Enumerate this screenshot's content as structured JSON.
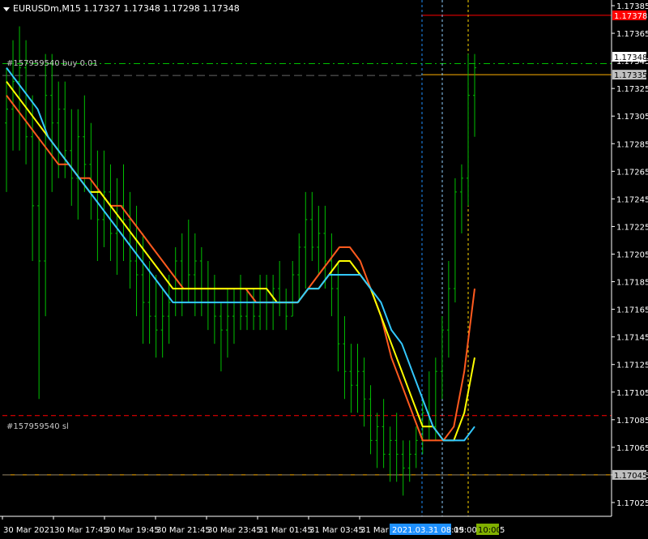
{
  "window": {
    "symbol_line": "EURUSDm,M15  1.17327 1.17348 1.17298 1.17348"
  },
  "order_labels": {
    "buy": "#157959540 buy 0.01",
    "sl": "#157959540 sl"
  },
  "price_tags": [
    {
      "price": 1.17378,
      "label": "1.17378",
      "bg": "#ff0000",
      "fg": "#ffffff"
    },
    {
      "price": 1.17348,
      "label": "1.17348",
      "bg": "#ffffff",
      "fg": "#000000"
    },
    {
      "price": 1.17335,
      "label": "1.17335",
      "bg": "#c0c0c0",
      "fg": "#000000"
    },
    {
      "price": 1.17045,
      "label": "1.17045",
      "bg": "#c0c0c0",
      "fg": "#000000"
    }
  ],
  "time_labels": {
    "hover": "2021.03.31 08:15",
    "hover_tail": "09:00",
    "marker": "10:00",
    "marker_tail": "5"
  },
  "colors": {
    "background": "#000000",
    "bars": "#00c000",
    "axis": "#ffffff",
    "ma_fast": "#ff5a1e",
    "ma_mid": "#ffff00",
    "ma_slow": "#33c8ff",
    "stop_line": "#ff0000",
    "entry_line": "#00c000",
    "level_line": "#ffb000",
    "hover_bg": "#1e90ff",
    "marker_bg": "#80b000"
  },
  "chart_data": {
    "type": "ohlc",
    "symbol": "EURUSDm",
    "timeframe": "M15",
    "ylim": [
      1.17015,
      1.17385
    ],
    "y_ticks": [
      "1.17385",
      "1.17365",
      "1.17345",
      "1.17325",
      "1.17305",
      "1.17285",
      "1.17265",
      "1.17245",
      "1.17225",
      "1.17205",
      "1.17185",
      "1.17165",
      "1.17145",
      "1.17125",
      "1.17105",
      "1.17085",
      "1.17065",
      "1.17045",
      "1.17025"
    ],
    "x_ticks": [
      "30 Mar 2021",
      "30 Mar 17:45",
      "30 Mar 19:45",
      "30 Mar 21:45",
      "30 Mar 23:45",
      "31 Mar 01:45",
      "31 Mar 03:45",
      "31 Mar 05"
    ],
    "horizontal_levels": [
      {
        "name": "stop_loss_level",
        "price": 1.17378
      },
      {
        "name": "buy 0.01 entry",
        "price": 1.17343
      },
      {
        "name": "level_1",
        "price": 1.17335
      },
      {
        "name": "sl",
        "price": 1.17088
      },
      {
        "name": "level_2",
        "price": 1.17045
      }
    ],
    "bars": [
      [
        1.173,
        1.1734,
        1.1725,
        1.1731
      ],
      [
        1.1731,
        1.1736,
        1.1728,
        1.1733
      ],
      [
        1.1733,
        1.1737,
        1.1728,
        1.1734
      ],
      [
        1.1734,
        1.1736,
        1.1727,
        1.1729
      ],
      [
        1.1729,
        1.1732,
        1.172,
        1.1724
      ],
      [
        1.1724,
        1.1729,
        1.171,
        1.172
      ],
      [
        1.172,
        1.1735,
        1.1716,
        1.1732
      ],
      [
        1.1732,
        1.1735,
        1.1725,
        1.173
      ],
      [
        1.173,
        1.1733,
        1.1726,
        1.1731
      ],
      [
        1.1731,
        1.1733,
        1.1726,
        1.1728
      ],
      [
        1.1728,
        1.1731,
        1.1724,
        1.1726
      ],
      [
        1.1726,
        1.1731,
        1.1723,
        1.1729
      ],
      [
        1.1729,
        1.1732,
        1.1725,
        1.1727
      ],
      [
        1.1727,
        1.173,
        1.1723,
        1.1725
      ],
      [
        1.1725,
        1.1728,
        1.172,
        1.1723
      ],
      [
        1.1723,
        1.1728,
        1.1721,
        1.1725
      ],
      [
        1.1725,
        1.1727,
        1.172,
        1.1722
      ],
      [
        1.1722,
        1.1726,
        1.1719,
        1.1724
      ],
      [
        1.1724,
        1.1727,
        1.172,
        1.1723
      ],
      [
        1.1723,
        1.1725,
        1.1718,
        1.172
      ],
      [
        1.172,
        1.1724,
        1.1716,
        1.1719
      ],
      [
        1.1719,
        1.1722,
        1.1714,
        1.1717
      ],
      [
        1.1717,
        1.172,
        1.1714,
        1.1716
      ],
      [
        1.1716,
        1.1719,
        1.1713,
        1.1715
      ],
      [
        1.1715,
        1.1718,
        1.1713,
        1.1716
      ],
      [
        1.1716,
        1.1719,
        1.1714,
        1.1717
      ],
      [
        1.1717,
        1.1721,
        1.1716,
        1.172
      ],
      [
        1.172,
        1.1722,
        1.1716,
        1.1718
      ],
      [
        1.1718,
        1.1723,
        1.1717,
        1.1719
      ],
      [
        1.1719,
        1.1722,
        1.1716,
        1.172
      ],
      [
        1.172,
        1.1721,
        1.1716,
        1.1718
      ],
      [
        1.1718,
        1.172,
        1.1715,
        1.1717
      ],
      [
        1.1717,
        1.1719,
        1.1714,
        1.1716
      ],
      [
        1.1716,
        1.1717,
        1.1712,
        1.1715
      ],
      [
        1.1715,
        1.1718,
        1.1713,
        1.1716
      ],
      [
        1.1716,
        1.1718,
        1.1714,
        1.1717
      ],
      [
        1.1717,
        1.1719,
        1.1715,
        1.1716
      ],
      [
        1.1716,
        1.1718,
        1.1715,
        1.1717
      ],
      [
        1.1717,
        1.1718,
        1.1715,
        1.1716
      ],
      [
        1.1716,
        1.1719,
        1.1715,
        1.1718
      ],
      [
        1.1718,
        1.1719,
        1.1715,
        1.1717
      ],
      [
        1.1717,
        1.1719,
        1.1715,
        1.1718
      ],
      [
        1.1718,
        1.172,
        1.1716,
        1.1717
      ],
      [
        1.1717,
        1.1718,
        1.1715,
        1.1716
      ],
      [
        1.1716,
        1.172,
        1.1716,
        1.1719
      ],
      [
        1.1719,
        1.1722,
        1.1717,
        1.1721
      ],
      [
        1.1721,
        1.1725,
        1.1718,
        1.1723
      ],
      [
        1.1723,
        1.1725,
        1.172,
        1.1721
      ],
      [
        1.1721,
        1.1724,
        1.1719,
        1.1722
      ],
      [
        1.1722,
        1.1724,
        1.1718,
        1.172
      ],
      [
        1.172,
        1.1722,
        1.1716,
        1.1718
      ],
      [
        1.1718,
        1.172,
        1.1712,
        1.1714
      ],
      [
        1.1714,
        1.1716,
        1.171,
        1.1712
      ],
      [
        1.1712,
        1.1714,
        1.1709,
        1.1711
      ],
      [
        1.1711,
        1.1714,
        1.1709,
        1.1712
      ],
      [
        1.1712,
        1.1713,
        1.1708,
        1.171
      ],
      [
        1.171,
        1.1711,
        1.1706,
        1.1707
      ],
      [
        1.1707,
        1.1709,
        1.1705,
        1.1708
      ],
      [
        1.1708,
        1.171,
        1.1705,
        1.1706
      ],
      [
        1.1706,
        1.1708,
        1.1704,
        1.1707
      ],
      [
        1.1707,
        1.1709,
        1.1704,
        1.1706
      ],
      [
        1.1706,
        1.1707,
        1.1703,
        1.1705
      ],
      [
        1.1705,
        1.1707,
        1.1704,
        1.1706
      ],
      [
        1.1706,
        1.1708,
        1.1705,
        1.1707
      ],
      [
        1.1707,
        1.171,
        1.1706,
        1.1709
      ],
      [
        1.1709,
        1.1712,
        1.1707,
        1.1708
      ],
      [
        1.1708,
        1.1713,
        1.1707,
        1.1712
      ],
      [
        1.1712,
        1.1716,
        1.171,
        1.1715
      ],
      [
        1.1715,
        1.172,
        1.1713,
        1.1718
      ],
      [
        1.1718,
        1.1726,
        1.1717,
        1.1725
      ],
      [
        1.1725,
        1.1727,
        1.1722,
        1.1726
      ],
      [
        1.1726,
        1.1735,
        1.1724,
        1.1732
      ],
      [
        1.1732,
        1.1735,
        1.1729,
        1.1734
      ]
    ],
    "series": [
      {
        "name": "ma_fast",
        "color": "#ff5a1e",
        "values": [
          1.1732,
          1.1731,
          1.173,
          1.1729,
          1.1728,
          1.1727,
          1.1727,
          1.1726,
          1.1726,
          1.1725,
          1.1724,
          1.1724,
          1.1723,
          1.1722,
          1.1721,
          1.172,
          1.1719,
          1.1718,
          1.1718,
          1.1718,
          1.1718,
          1.1718,
          1.1718,
          1.1718,
          1.1717,
          1.1717,
          1.1717,
          1.1717,
          1.1717,
          1.1718,
          1.1719,
          1.172,
          1.1721,
          1.1721,
          1.172,
          1.1718,
          1.1716,
          1.1713,
          1.1711,
          1.1709,
          1.1707,
          1.1707,
          1.1707,
          1.1708,
          1.1712,
          1.1718
        ]
      },
      {
        "name": "ma_mid",
        "color": "#ffff00",
        "values": [
          1.1733,
          1.1732,
          1.1731,
          1.173,
          1.1729,
          1.1728,
          1.1727,
          1.1726,
          1.1725,
          1.1725,
          1.1724,
          1.1723,
          1.1722,
          1.1721,
          1.172,
          1.1719,
          1.1718,
          1.1718,
          1.1718,
          1.1718,
          1.1718,
          1.1718,
          1.1718,
          1.1718,
          1.1718,
          1.1718,
          1.1717,
          1.1717,
          1.1717,
          1.1718,
          1.1718,
          1.1719,
          1.172,
          1.172,
          1.1719,
          1.1718,
          1.1716,
          1.1714,
          1.1712,
          1.171,
          1.1708,
          1.1708,
          1.1707,
          1.1707,
          1.1709,
          1.1713
        ]
      },
      {
        "name": "ma_slow",
        "color": "#33c8ff",
        "values": [
          1.1734,
          1.1733,
          1.1732,
          1.1731,
          1.1729,
          1.1728,
          1.1727,
          1.1726,
          1.1725,
          1.1724,
          1.1723,
          1.1722,
          1.1721,
          1.172,
          1.1719,
          1.1718,
          1.1717,
          1.1717,
          1.1717,
          1.1717,
          1.1717,
          1.1717,
          1.1717,
          1.1717,
          1.1717,
          1.1717,
          1.1717,
          1.1717,
          1.1717,
          1.1718,
          1.1718,
          1.1719,
          1.1719,
          1.1719,
          1.1719,
          1.1718,
          1.1717,
          1.1715,
          1.1714,
          1.1712,
          1.171,
          1.1708,
          1.1707,
          1.1707,
          1.1707,
          1.1708
        ]
      }
    ]
  }
}
